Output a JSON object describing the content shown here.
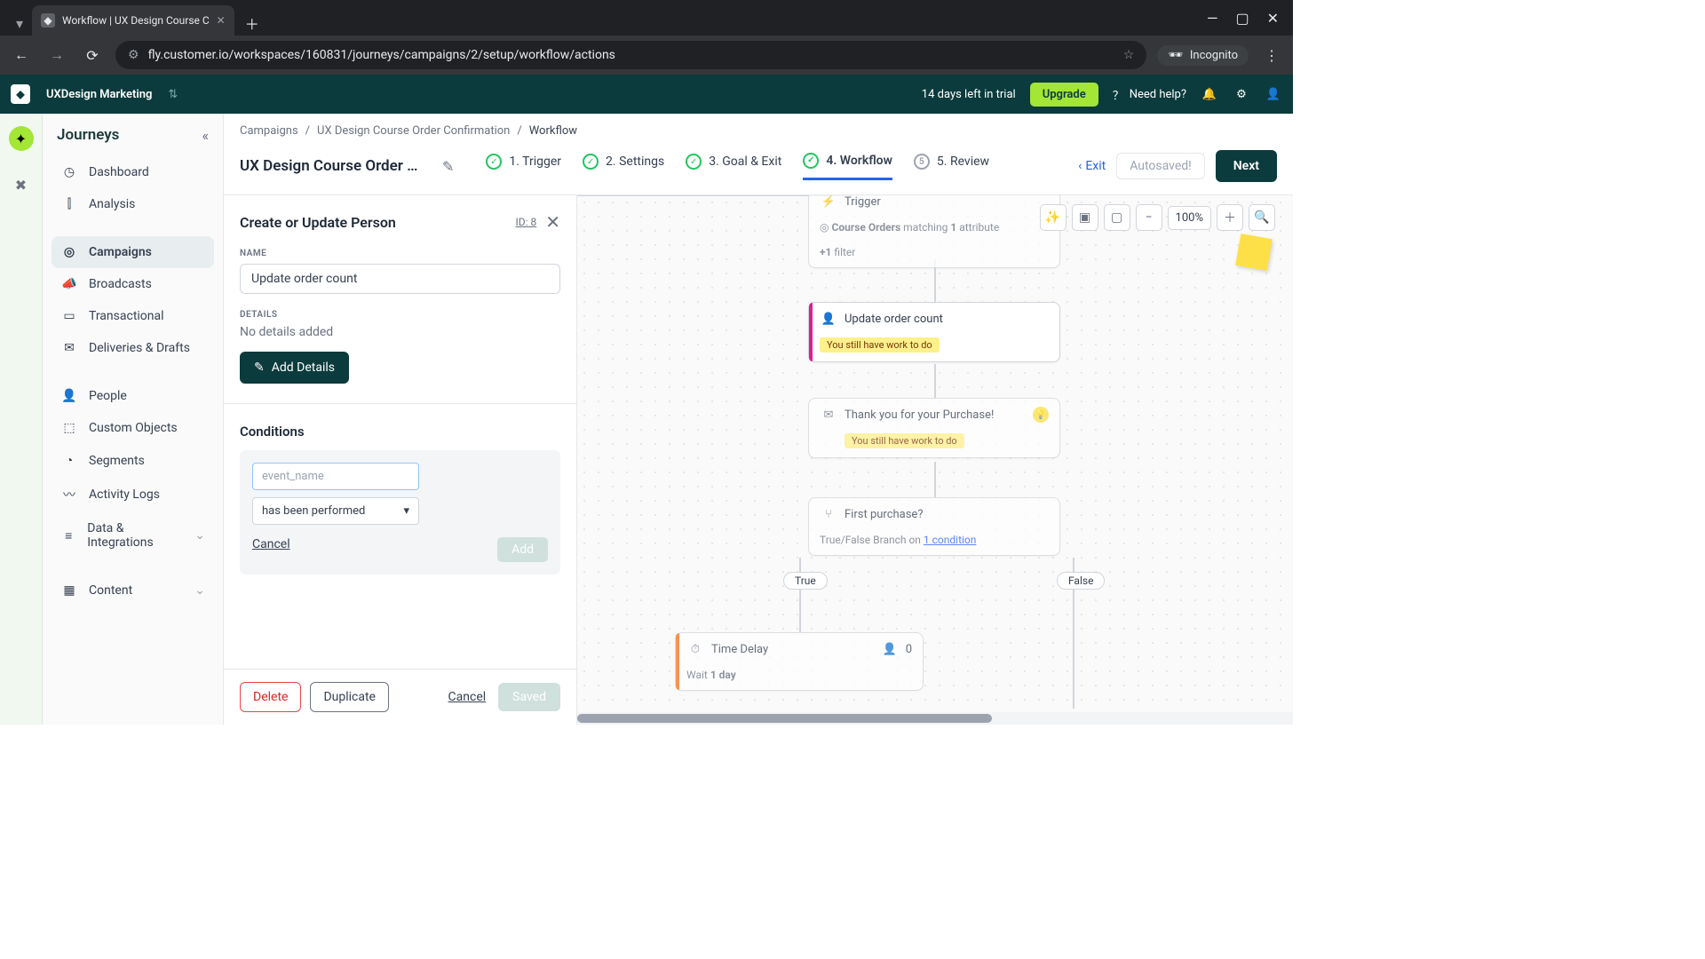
{
  "browser": {
    "tab_title": "Workflow | UX Design Course C",
    "url": "fly.customer.io/workspaces/160831/journeys/campaigns/2/setup/workflow/actions",
    "incognito": "Incognito"
  },
  "topbar": {
    "workspace": "UXDesign Marketing",
    "trial": "14 days left in trial",
    "upgrade": "Upgrade",
    "help": "Need help?"
  },
  "sidebar": {
    "title": "Journeys",
    "items": [
      "Dashboard",
      "Analysis",
      "Campaigns",
      "Broadcasts",
      "Transactional",
      "Deliveries & Drafts",
      "People",
      "Custom Objects",
      "Segments",
      "Activity Logs",
      "Data & Integrations",
      "Content"
    ]
  },
  "breadcrumb": {
    "a": "Campaigns",
    "b": "UX Design Course Order Confirmation",
    "c": "Workflow"
  },
  "stepbar": {
    "title": "UX Design Course Order Confir...",
    "steps": [
      "1. Trigger",
      "2. Settings",
      "3. Goal & Exit",
      "4. Workflow",
      "5. Review"
    ],
    "exit": "Exit",
    "autosaved": "Autosaved!",
    "next": "Next"
  },
  "panel": {
    "title": "Create or Update Person",
    "id": "ID: 8",
    "name_label": "NAME",
    "name_value": "Update order count",
    "details_label": "DETAILS",
    "details_text": "No details added",
    "add_details": "Add Details",
    "conditions_title": "Conditions",
    "event_placeholder": "event_name",
    "select_value": "has been performed",
    "cancel": "Cancel",
    "add": "Add",
    "delete": "Delete",
    "duplicate": "Duplicate",
    "cancel2": "Cancel",
    "saved": "Saved"
  },
  "canvas": {
    "zoom": "100%",
    "trigger": {
      "title": "Trigger",
      "seg": "Course Orders",
      "matching": "matching",
      "one": "1",
      "attr": "attribute",
      "plus": "+1",
      "filter": "filter"
    },
    "update": {
      "title": "Update order count",
      "warn": "You still have work to do"
    },
    "thanks": {
      "title": "Thank you for your Purchase!",
      "warn": "You still have work to do"
    },
    "branch": {
      "title": "First purchase?",
      "sub1": "True/False Branch on ",
      "cond": "1 condition"
    },
    "true": "True",
    "false": "False",
    "delay": {
      "title": "Time Delay",
      "count": "0",
      "wait": "Wait ",
      "dur": "1 day"
    }
  }
}
